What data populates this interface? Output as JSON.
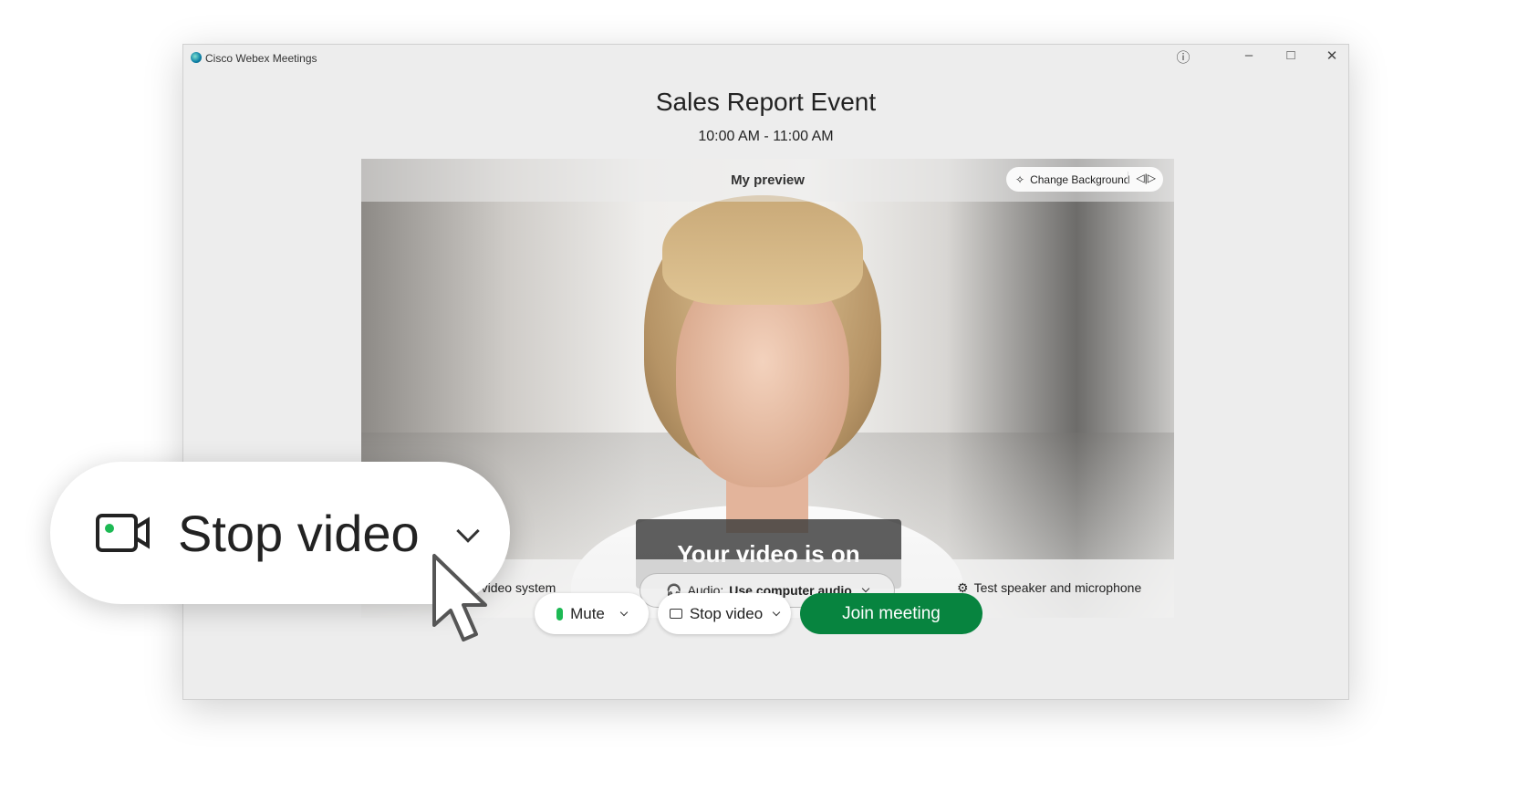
{
  "window": {
    "app_title": "Cisco Webex Meetings",
    "controls": [
      "help-icon",
      "minimize-icon",
      "maximize-icon",
      "close-icon"
    ]
  },
  "meeting": {
    "title": "Sales Report Event",
    "time": "10:00 AM - 11:00 AM"
  },
  "preview": {
    "label": "My preview",
    "change_background": "Change Background",
    "status": "Your video is on"
  },
  "video_bar": {
    "connect": "Connect to video system",
    "audio_prefix": "Audio:",
    "audio_value": "Use computer audio",
    "test": "Test speaker and microphone"
  },
  "controls": {
    "mute": "Mute",
    "stop_video": "Stop video",
    "join": "Join meeting"
  },
  "callout": {
    "label": "Stop video"
  },
  "colors": {
    "join": "#07843f",
    "video_on_dot": "#1db954",
    "audio_check": "#1d8fe0"
  }
}
